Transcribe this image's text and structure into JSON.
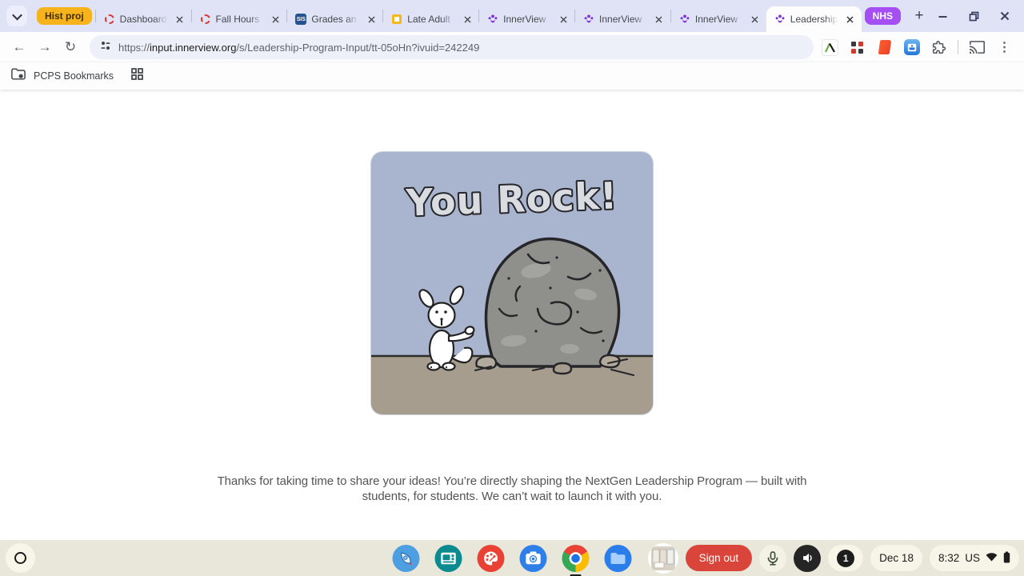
{
  "browser": {
    "tab_strip": {
      "groups": [
        {
          "label": "Hist proj",
          "color": "#f7b31c"
        },
        {
          "label": "NHS",
          "color": "#a44ef4"
        }
      ],
      "tabs": [
        {
          "title": "Dashboard",
          "favicon": "red-dashed-circle"
        },
        {
          "title": "Fall Hours",
          "favicon": "red-dashed-circle"
        },
        {
          "title": "Grades an",
          "favicon": "sis-badge"
        },
        {
          "title": "Late Adult",
          "favicon": "yellow-square"
        },
        {
          "title": "InnerView",
          "favicon": "innerview-logo"
        },
        {
          "title": "InnerView",
          "favicon": "innerview-logo"
        },
        {
          "title": "InnerView",
          "favicon": "innerview-logo"
        },
        {
          "title": "Leadership",
          "favicon": "innerview-logo",
          "active": true
        }
      ],
      "sis_label": "SIS",
      "new_tab_glyph": "+"
    },
    "toolbar": {
      "url_scheme": "https://",
      "url_host": "input.innerview.org",
      "url_path": "/s/Leadership-Program-Input/tt-05oHn?ivuid=242249"
    },
    "bookmarks_bar": {
      "folder_label": "PCPS Bookmarks"
    }
  },
  "page": {
    "card_title": "You Rock!",
    "message": "Thanks for taking  time to share your ideas! You’re directly shaping the NextGen Leadership Program — built with students, for students. We can’t wait to launch it with you."
  },
  "shelf": {
    "sign_out_label": "Sign out",
    "notification_count": "1",
    "date": "Dec 18",
    "time": "8:32",
    "keyboard_layout": "US",
    "apps": [
      "explore",
      "gallery",
      "canvas",
      "camera",
      "chrome",
      "files"
    ]
  },
  "icons": {
    "back_glyph": "←",
    "forward_glyph": "→",
    "reload_glyph": "↻",
    "kebab_glyph": "⋮"
  },
  "colors": {
    "sign_out_red": "#d9453a",
    "group_yellow": "#f7b31c",
    "group_purple": "#a44ef4",
    "card_sky": "#a9b5ce",
    "card_ground": "#a69d8f"
  }
}
